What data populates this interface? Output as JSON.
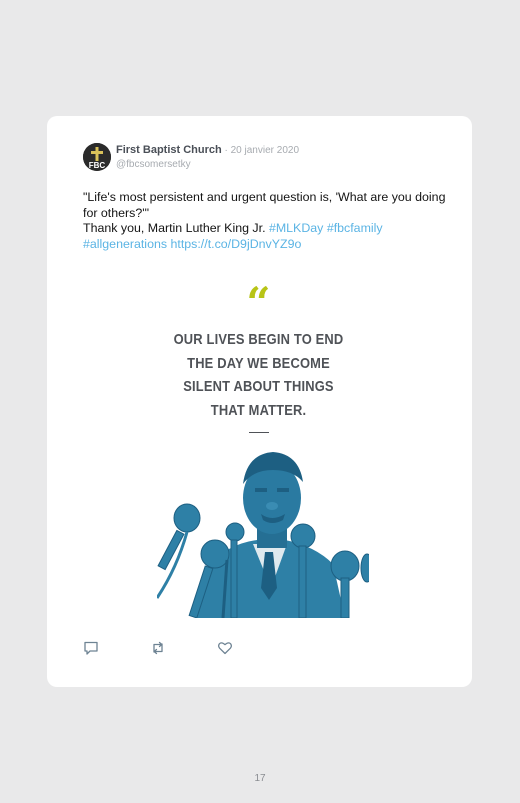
{
  "tweet": {
    "display_name": "First Baptist Church",
    "separator": " · ",
    "date": "20 janvier 2020",
    "handle": "@fbcsomersetky",
    "avatar_text": "FBC",
    "text": {
      "line1": "\"Life's most persistent and urgent question is, 'What are you doing for others?'\"",
      "line2_prefix": "Thank you, Martin Luther King Jr. ",
      "hashtag1": "#MLKDay",
      "space1": " ",
      "hashtag2": "#fbcfamily",
      "hashtag3": "#allgenerations",
      "space2": " ",
      "link": "https://t.co/D9jDnvYZ9o"
    },
    "media": {
      "quote_mark": "“",
      "quote_lines": [
        "OUR LIVES BEGIN TO END",
        "THE DAY WE BECOME",
        "SILENT ABOUT THINGS",
        "THAT MATTER."
      ]
    },
    "actions": {
      "reply_icon": "reply-icon",
      "retweet_icon": "retweet-icon",
      "like_icon": "heart-icon"
    }
  },
  "colors": {
    "page_background": "#e9e9ea",
    "card_background": "#ffffff",
    "link": "#5bb4e4",
    "quote_accent": "#b8c416",
    "photo_tint": "#2e80a6"
  },
  "page": {
    "number": "17"
  }
}
